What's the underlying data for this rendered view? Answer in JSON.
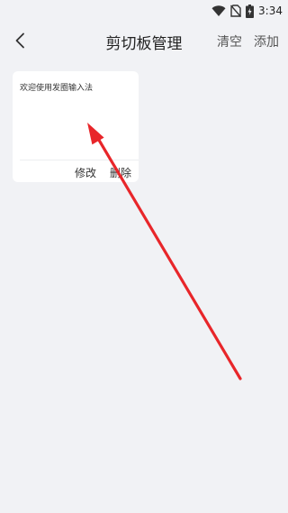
{
  "status_bar": {
    "time": "3:34",
    "icons": [
      "wifi-icon",
      "no-sim-icon",
      "battery-charging-icon"
    ]
  },
  "header": {
    "back_icon": "chevron-left-icon",
    "title": "剪切板管理",
    "clear_label": "清空",
    "add_label": "添加"
  },
  "clips": [
    {
      "text": "欢迎使用发圈输入法",
      "edit_label": "修改",
      "delete_label": "删除"
    }
  ],
  "colors": {
    "background": "#f1f2f5",
    "card": "#ffffff",
    "annotation": "#e8262a"
  }
}
